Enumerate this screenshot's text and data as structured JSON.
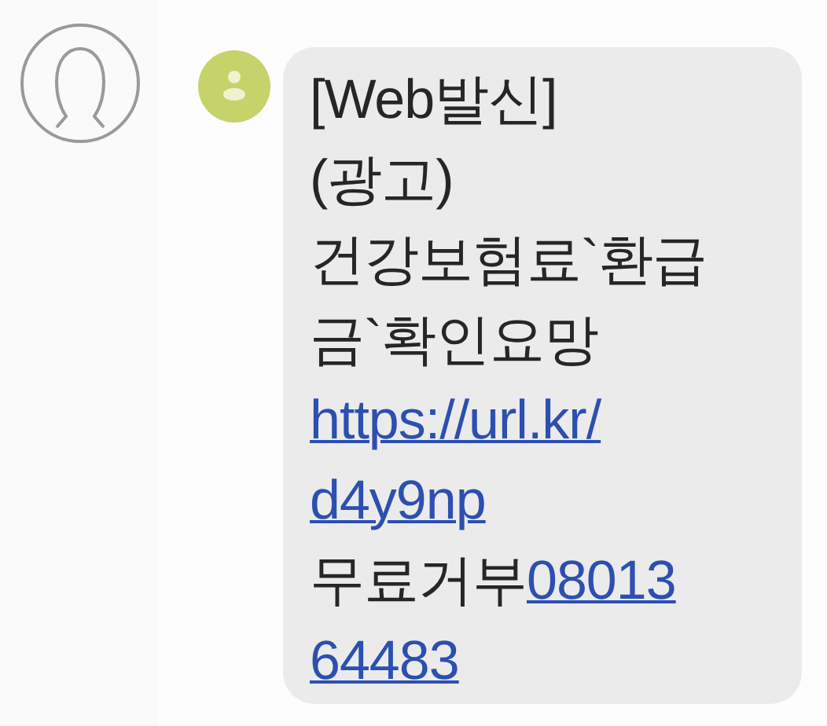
{
  "message": {
    "lines": [
      [
        {
          "kind": "text",
          "text": "[Web발신]"
        }
      ],
      [
        {
          "kind": "text",
          "text": "(광고)"
        }
      ],
      [
        {
          "kind": "text",
          "text": "건강보험료`환급"
        }
      ],
      [
        {
          "kind": "text",
          "text": "금`확인요망"
        }
      ],
      [
        {
          "kind": "link",
          "text": "https://url.kr/"
        }
      ],
      [
        {
          "kind": "link",
          "text": "d4y9np"
        }
      ],
      [
        {
          "kind": "text",
          "text": "무료거부"
        },
        {
          "kind": "link",
          "text": "08013"
        }
      ],
      [
        {
          "kind": "link",
          "text": "64483"
        }
      ]
    ]
  }
}
